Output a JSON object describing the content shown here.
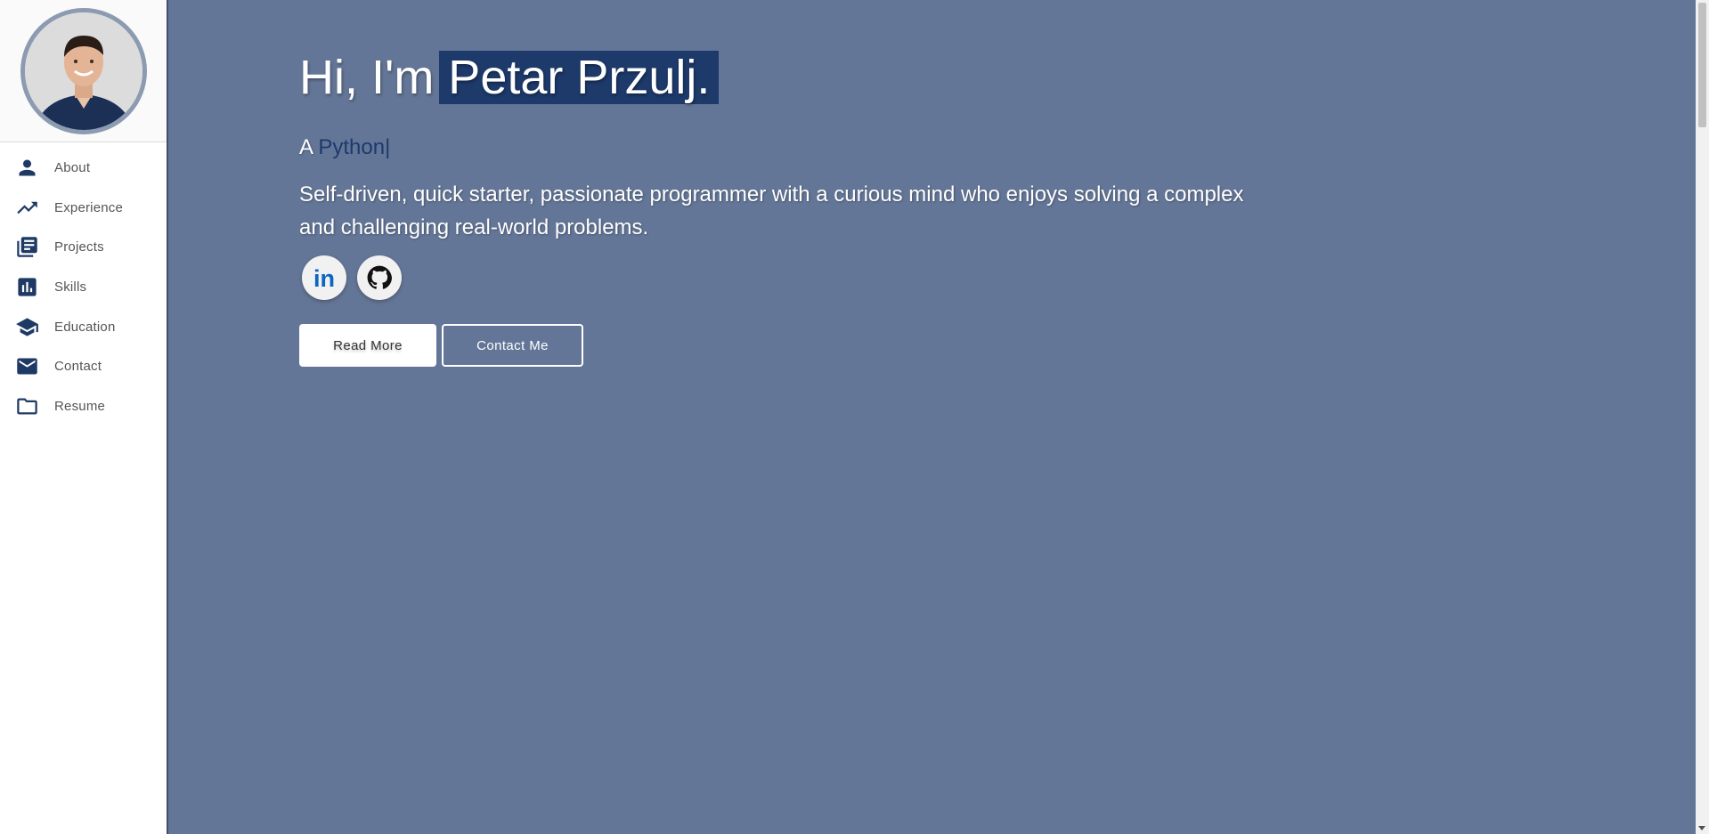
{
  "sidebar": {
    "avatar_alt": "Petar Przulj",
    "items": [
      {
        "label": "About",
        "icon": "person-icon"
      },
      {
        "label": "Experience",
        "icon": "trending-up-icon"
      },
      {
        "label": "Projects",
        "icon": "library-books-icon"
      },
      {
        "label": "Skills",
        "icon": "bar-chart-icon"
      },
      {
        "label": "Education",
        "icon": "school-icon"
      },
      {
        "label": "Contact",
        "icon": "mail-icon"
      },
      {
        "label": "Resume",
        "icon": "folder-icon"
      }
    ]
  },
  "hero": {
    "greeting": "Hi, I'm",
    "name": "Petar Przulj.",
    "subtitle_prefix": "A",
    "typed_text": "Python",
    "typed_cursor": "|",
    "description": "Self-driven, quick starter, passionate programmer with a curious mind who enjoys solving a complex and challenging real-world problems."
  },
  "socials": [
    {
      "name": "linkedin-icon",
      "label": "in"
    },
    {
      "name": "github-icon"
    }
  ],
  "buttons": {
    "read_more": "Read More",
    "contact_me": "Contact Me"
  },
  "colors": {
    "background": "#647697",
    "accent": "#1d3a6b",
    "linkedin": "#0a66c2"
  }
}
